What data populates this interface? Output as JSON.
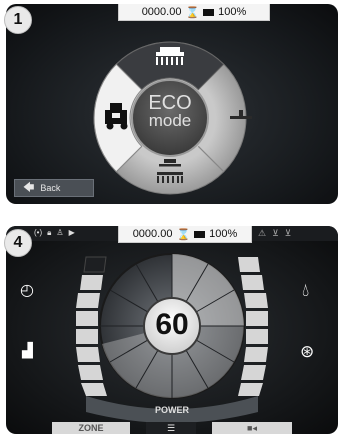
{
  "screen1": {
    "badge": "1",
    "status": {
      "hours": "0000.00",
      "battery": "100%"
    },
    "center": {
      "line1": "ECO",
      "line2": "mode"
    },
    "back_label": "Back"
  },
  "screen2": {
    "badge": "4",
    "status": {
      "hours": "0000.00",
      "battery": "100%"
    },
    "power_value": "60",
    "power_label": "POWER",
    "zone_label": "ZONE",
    "colors": {
      "accent": "#8a8a8a",
      "gauge_light": "#dcdcdc",
      "gauge_dark": "#555a5f"
    }
  }
}
